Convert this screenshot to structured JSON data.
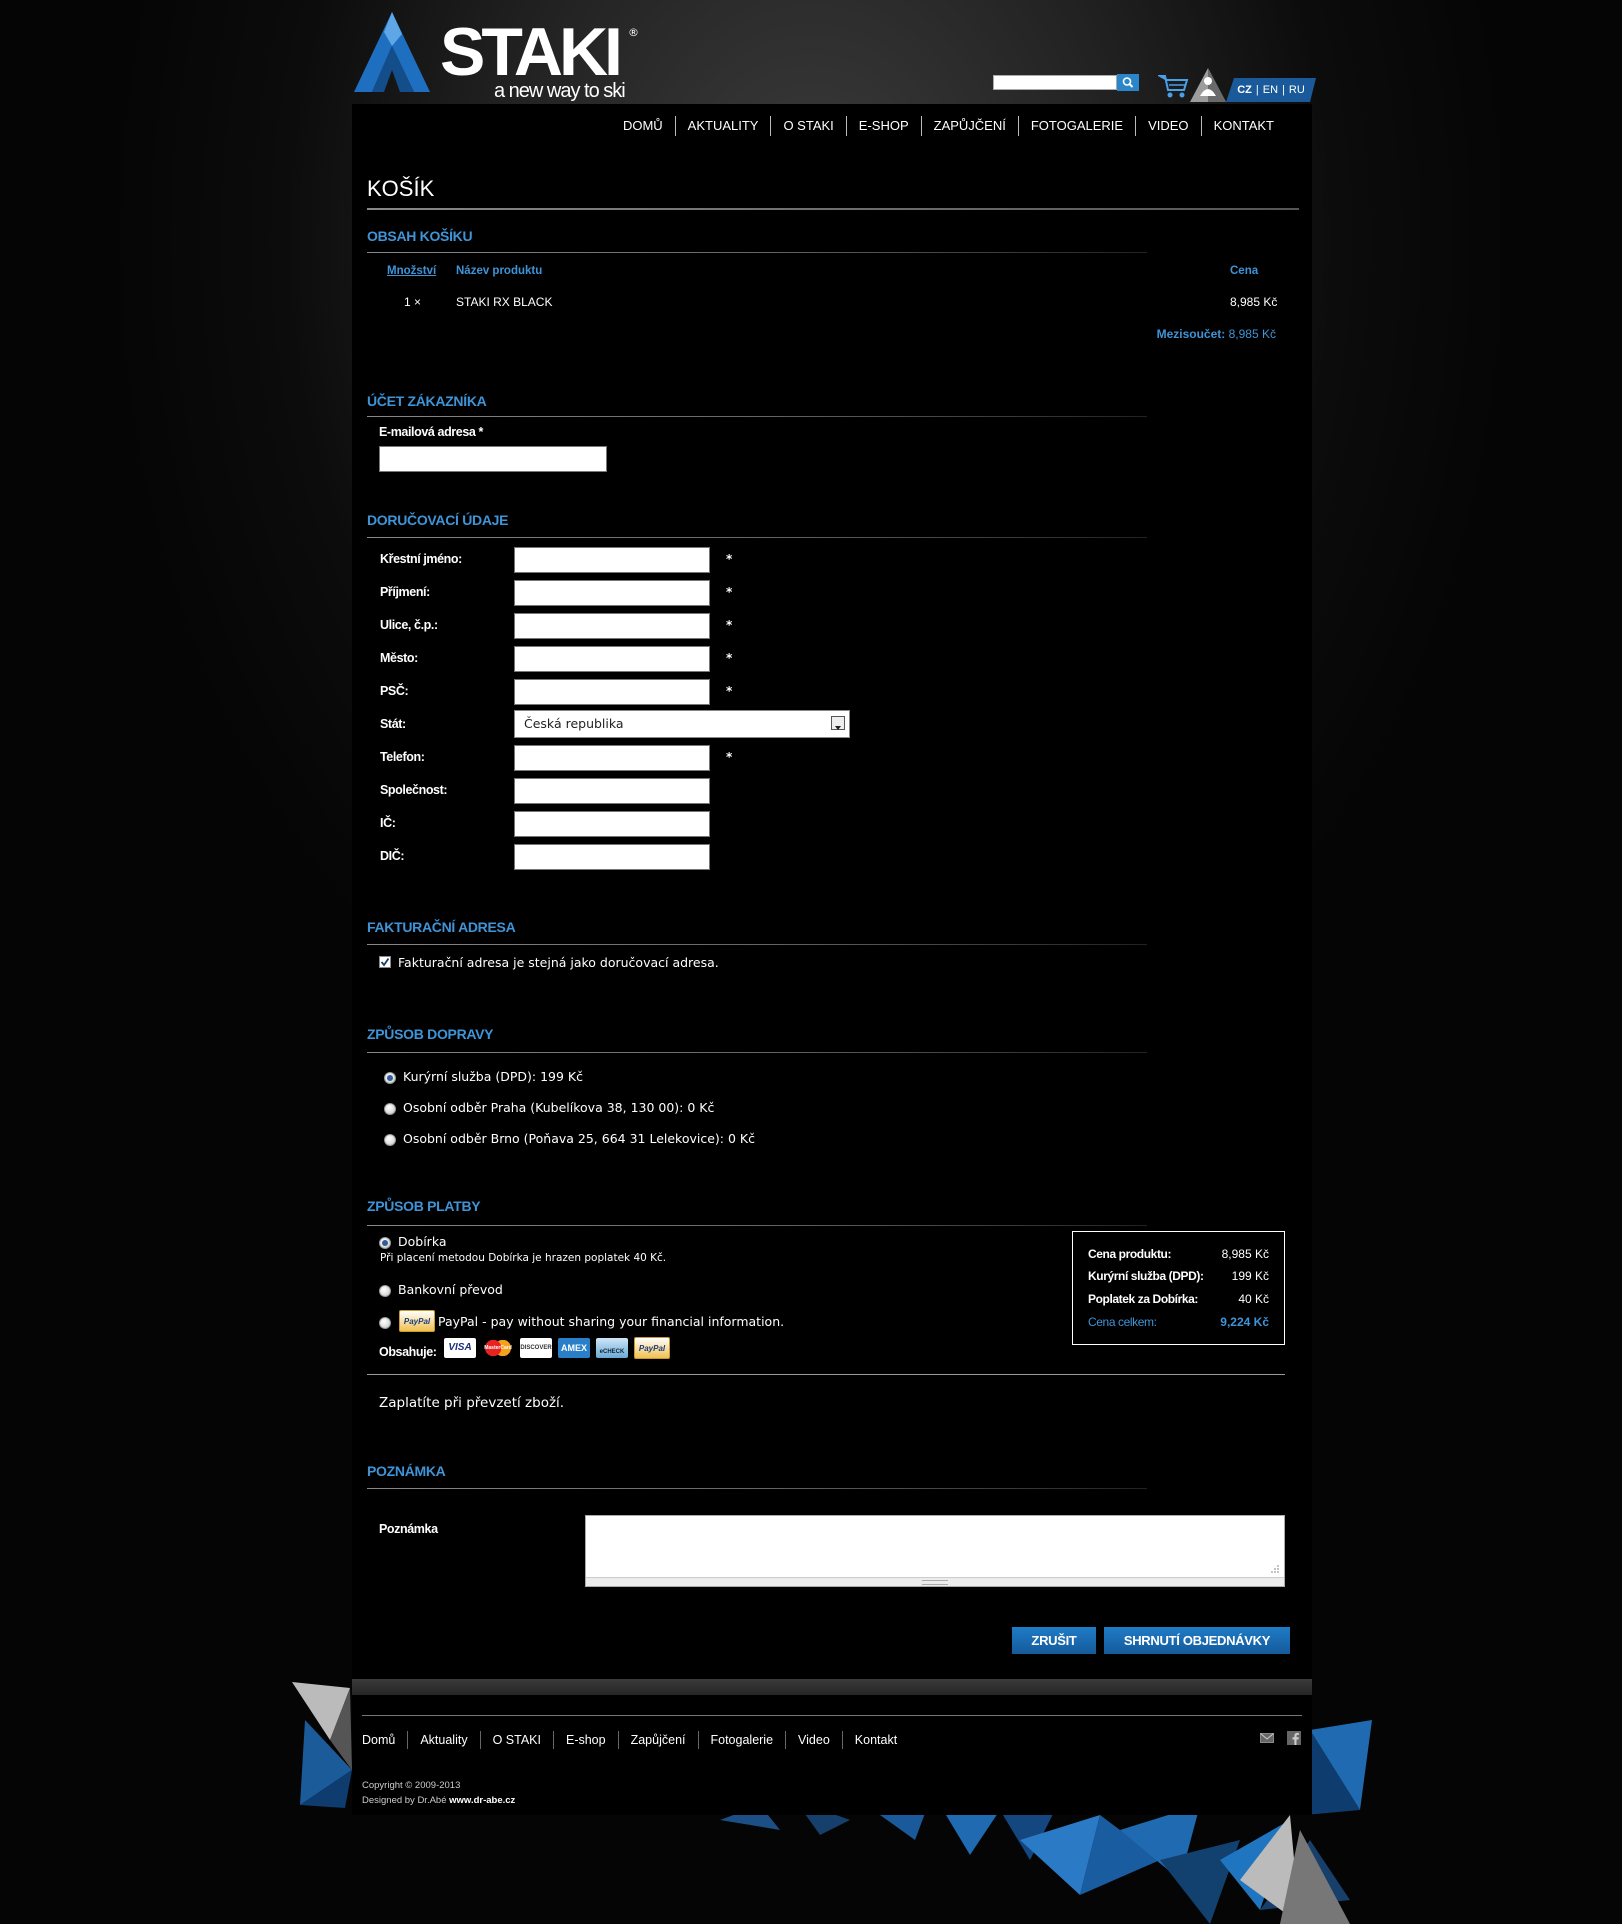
{
  "header": {
    "logo_text": "STAKI",
    "logo_reg": "®",
    "tagline": "a new way to ski",
    "search_placeholder": "",
    "languages": [
      {
        "code": "CZ",
        "active": true
      },
      {
        "code": "EN",
        "active": false
      },
      {
        "code": "RU",
        "active": false
      }
    ],
    "nav": [
      "DOMŮ",
      "AKTUALITY",
      "O STAKI",
      "E-SHOP",
      "ZAPŮJČENÍ",
      "FOTOGALERIE",
      "VIDEO",
      "KONTAKT"
    ]
  },
  "page": {
    "title": "KOŠÍK"
  },
  "cart": {
    "heading": "OBSAH KOŠÍKU",
    "col_qty": "Množství",
    "col_name": "Název produktu",
    "col_price": "Cena",
    "items": [
      {
        "qty": "1 ×",
        "name": "STAKI RX BLACK",
        "price": "8,985 Kč"
      }
    ],
    "subtotal_label": "Mezisoučet:",
    "subtotal_value": "8,985 Kč"
  },
  "account": {
    "heading": "ÚČET ZÁKAZNÍKA",
    "email_label": "E-mailová adresa *",
    "email_value": ""
  },
  "delivery": {
    "heading": "DORUČOVACÍ ÚDAJE",
    "fields": [
      {
        "label": "Křestní jméno:",
        "value": "",
        "required": "*"
      },
      {
        "label": "Příjmení:",
        "value": "",
        "required": "*"
      },
      {
        "label": "Ulice, č.p.:",
        "value": "",
        "required": "*"
      },
      {
        "label": "Město:",
        "value": "",
        "required": "*"
      },
      {
        "label": "PSČ:",
        "value": "",
        "required": "*"
      }
    ],
    "state_label": "Stát:",
    "state_value": "Česká republika",
    "phone_label": "Telefon:",
    "phone_required": "*",
    "company_label": "Společnost:",
    "ic_label": "IČ:",
    "dic_label": "DIČ:"
  },
  "billing": {
    "heading": "FAKTURAČNÍ ADRESA",
    "same_address_label": "Fakturační adresa je stejná jako doručovací adresa.",
    "same_address_checked": true
  },
  "shipping": {
    "heading": "ZPŮSOB DOPRAVY",
    "options": [
      {
        "label": "Kurýrní služba (DPD): 199 Kč",
        "checked": true
      },
      {
        "label": "Osobní odběr Praha (Kubelíkova 38, 130 00): 0 Kč",
        "checked": false
      },
      {
        "label": "Osobní odběr Brno (Poňava 25, 664 31 Lelekovice): 0 Kč",
        "checked": false
      }
    ]
  },
  "payment": {
    "heading": "ZPŮSOB PLATBY",
    "cod_label": "Dobírka",
    "cod_note": "Při placení metodou Dobírka je hrazen poplatek 40 Kč.",
    "bank_label": "Bankovní převod",
    "paypal_badge": "PayPal",
    "paypal_label": "PayPal - pay without sharing your financial information.",
    "contains_label": "Obsahuje:",
    "cards": [
      "VISA",
      "MasterCard",
      "DISCOVER",
      "AMEX",
      "eCHECK",
      "PayPal"
    ],
    "info_text": "Zaplatíte při převzetí zboží."
  },
  "summary": {
    "rows": [
      {
        "label": "Cena produktu:",
        "value": "8,985 Kč"
      },
      {
        "label": "Kurýrní služba (DPD):",
        "value": "199 Kč"
      },
      {
        "label": "Poplatek za Dobírka:",
        "value": "40 Kč"
      }
    ],
    "total_label": "Cena celkem:",
    "total_value": "9,224 Kč"
  },
  "note": {
    "heading": "POZNÁMKA",
    "label": "Poznámka",
    "value": ""
  },
  "buttons": {
    "cancel": "ZRUŠIT",
    "summary": "SHRNUTÍ OBJEDNÁVKY"
  },
  "footer": {
    "nav": [
      "Domů",
      "Aktuality",
      "O STAKI",
      "E-shop",
      "Zapůjčení",
      "Fotogalerie",
      "Video",
      "Kontakt"
    ],
    "copyright": "Copyright © 2009-2013",
    "designed_prefix": "Designed by Dr.Abé",
    "designed_site": "www.dr-abe.cz"
  },
  "colors": {
    "accent": "#3f94d8",
    "button": "#1f7cc7",
    "background": "#000000"
  },
  "icons": [
    "search-icon",
    "cart-icon",
    "user-icon",
    "mail-icon",
    "facebook-icon",
    "dropdown-arrow-icon"
  ]
}
